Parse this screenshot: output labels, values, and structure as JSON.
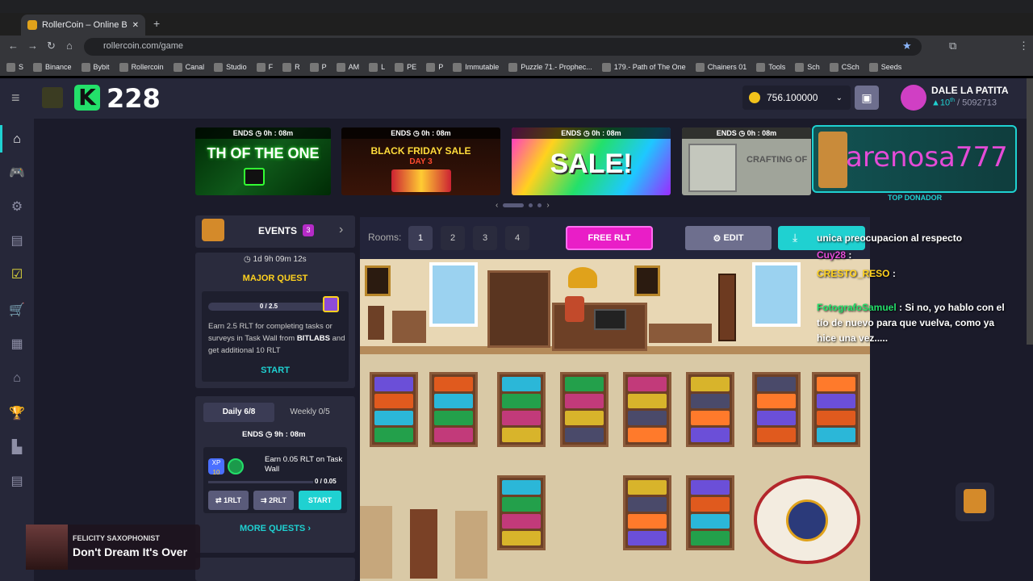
{
  "browser": {
    "tab_title": "RollerCoin – Online Bitcoin Mini",
    "url": "rollercoin.com/game",
    "bookmarks": [
      "S",
      "Binance",
      "Bybit",
      "Rollercoin",
      "Canal",
      "Studio",
      "F",
      "R",
      "P",
      "AM",
      "L",
      "PE",
      "P",
      "Immutable",
      "Puzzle 71.- Prophec...",
      "179.- Path of The One",
      "Chainers 01",
      "Tools",
      "Sch",
      "CSch",
      "Seeds"
    ]
  },
  "header": {
    "level": "228",
    "balance": "756.100000",
    "username": "DALE LA PATITA",
    "rank": "10",
    "rank_suffix": "th",
    "rank_total": "/ 5092713"
  },
  "banners": [
    {
      "ends": "ENDS",
      "time": "0h : 08m",
      "text": "TH OF THE ONE"
    },
    {
      "ends": "ENDS",
      "time": "0h : 08m",
      "text": "BLACK FRIDAY SALE",
      "sub": "DAY 3"
    },
    {
      "ends": "ENDS",
      "time": "0h : 08m",
      "text": "SALE!"
    },
    {
      "ends": "ENDS",
      "time": "0h : 08m",
      "text": "CRAFTING OF"
    }
  ],
  "donor": {
    "name": "arenosa777",
    "label": "TOP DONADOR"
  },
  "events": {
    "title": "EVENTS",
    "count": "3",
    "timer": "1d 9h 09m 12s",
    "major_quest": "MAJOR QUEST",
    "progress": "0 / 2.5",
    "progress_fraction": 0,
    "desc_1": "Earn 2.5 RLT for completing tasks or surveys in Task Wall from ",
    "desc_brand": "BITLABS",
    "desc_2": " and get additional 10 RLT",
    "start": "START"
  },
  "daily": {
    "tab_daily": "Daily 6/8",
    "tab_weekly": "Weekly 0/5",
    "ends": "ENDS",
    "ends_time": "9h : 08m",
    "quest_text": "Earn 0.05 RLT on Task Wall",
    "xp": "XP",
    "xp_val": "10",
    "progress": "0 / 0.05",
    "btn1": "1RLT",
    "btn2": "2RLT",
    "start": "START",
    "more": "MORE QUESTS"
  },
  "room": {
    "label": "Rooms:",
    "rooms": [
      "1",
      "2",
      "3",
      "4"
    ],
    "free_rlt": "FREE RLT",
    "edit": "EDIT"
  },
  "chat": [
    {
      "user": "",
      "text": "unica preocupacion al respecto"
    },
    {
      "user": "Cuy28",
      "text": ":"
    },
    {
      "user": "CRESTO_RESO",
      "text": ":"
    },
    {
      "user": "FotografoSamuel",
      "text": ": Si no, yo hablo con el tío de nuevo para que vuelva, como ya hice una vez....."
    }
  ],
  "music": {
    "artist": "FELICITY SAXOPHONIST",
    "title": "Don't Dream It's Over"
  },
  "colors": {
    "accent": "#1fd1d1",
    "pink": "#e91ec7",
    "brand_green": "#23e06a"
  }
}
